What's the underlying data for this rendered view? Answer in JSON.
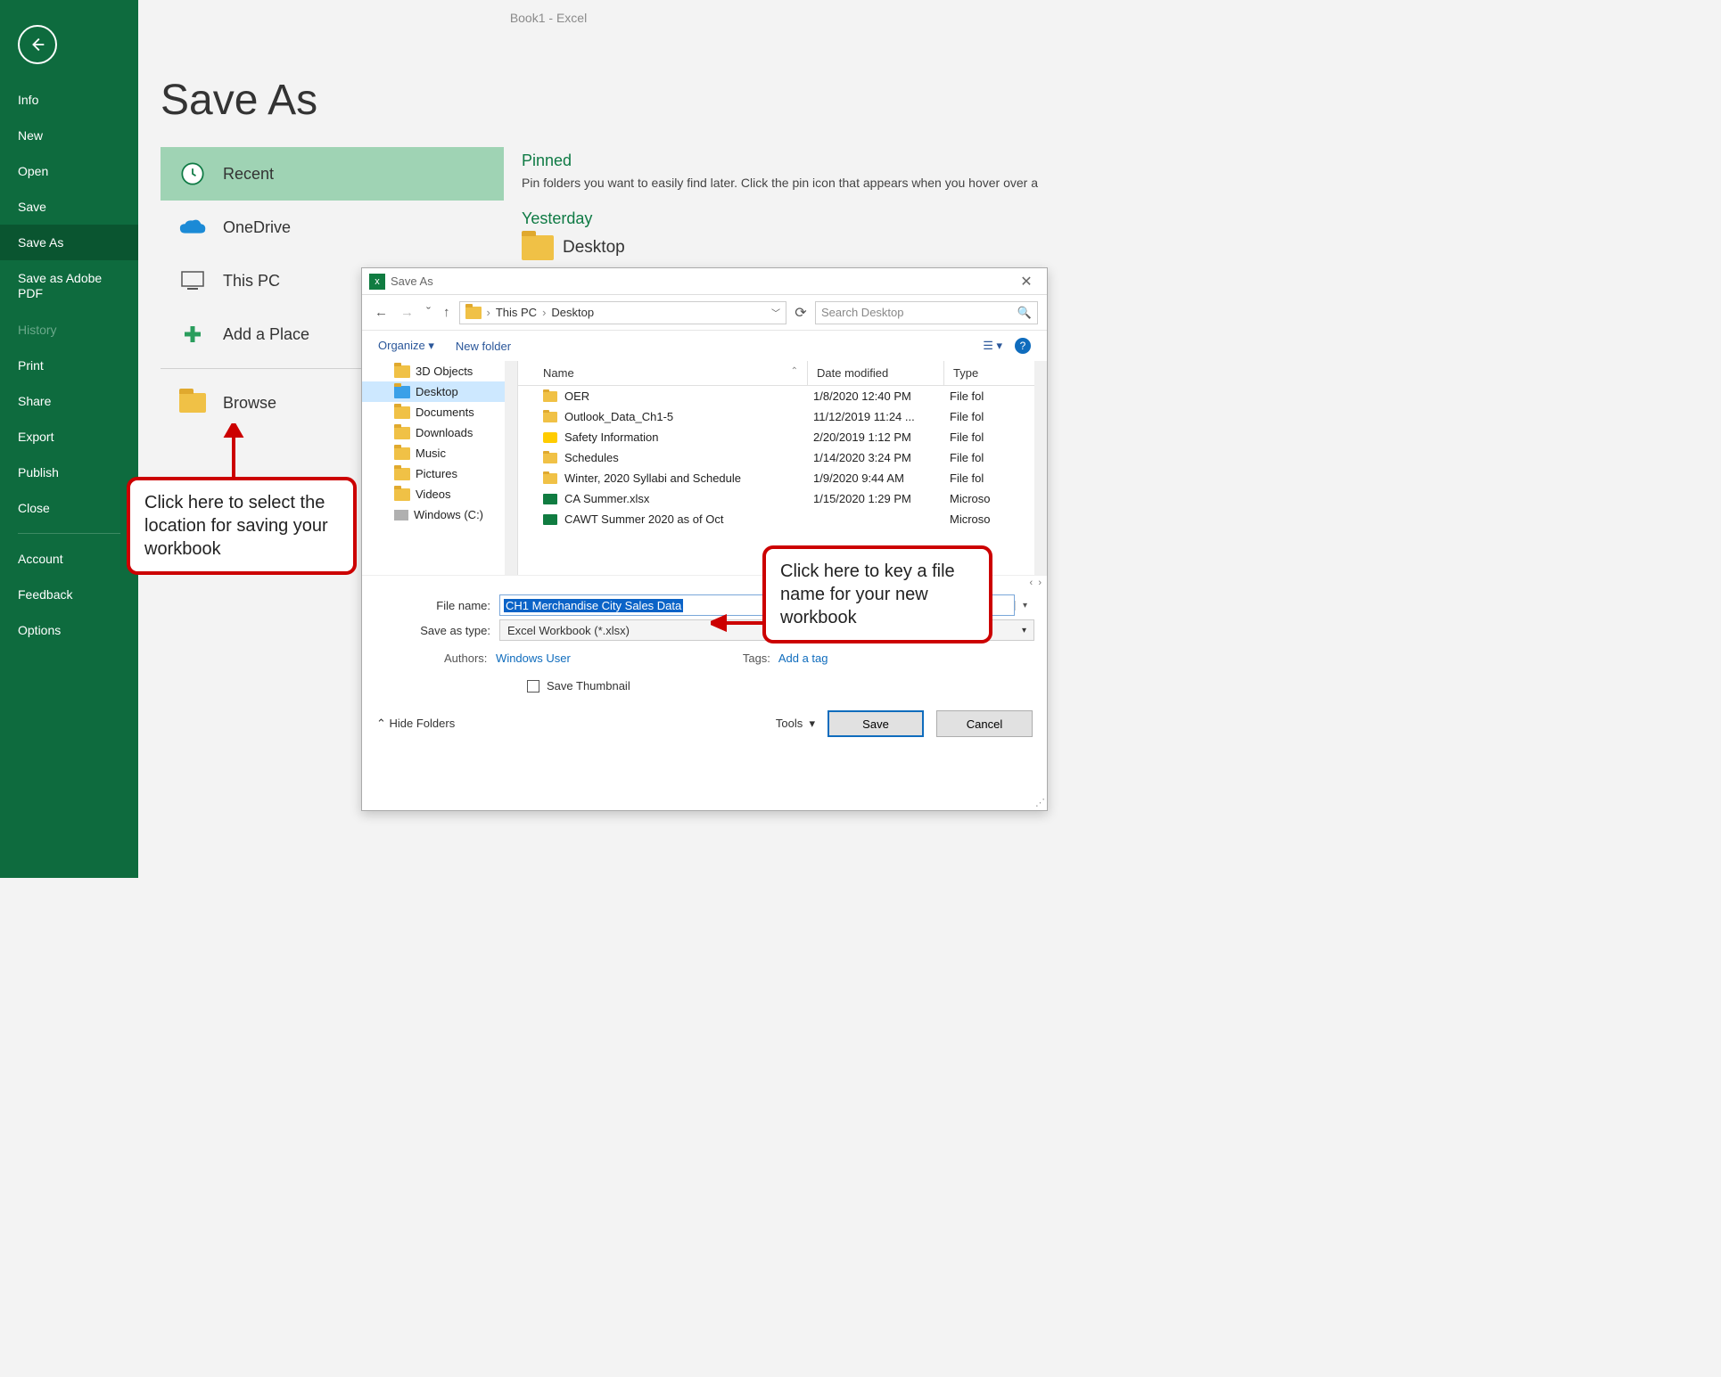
{
  "top_title": "Book1  -  Excel",
  "page_title": "Save As",
  "sidebar": {
    "items": [
      {
        "label": "Info"
      },
      {
        "label": "New"
      },
      {
        "label": "Open"
      },
      {
        "label": "Save"
      },
      {
        "label": "Save As"
      },
      {
        "label": "Save as Adobe PDF"
      },
      {
        "label": "History"
      },
      {
        "label": "Print"
      },
      {
        "label": "Share"
      },
      {
        "label": "Export"
      },
      {
        "label": "Publish"
      },
      {
        "label": "Close"
      }
    ],
    "bottom": [
      "Account",
      "Feedback",
      "Options"
    ]
  },
  "locations": {
    "recent": "Recent",
    "onedrive": "OneDrive",
    "thispc": "This PC",
    "addplace": "Add a Place",
    "browse": "Browse"
  },
  "pinned": {
    "heading": "Pinned",
    "text": "Pin folders you want to easily find later. Click the pin icon that appears when you hover over a",
    "yesterday": "Yesterday",
    "desktop": "Desktop"
  },
  "dialog": {
    "title": "Save As",
    "breadcrumb": {
      "root": "This PC",
      "leaf": "Desktop"
    },
    "search_placeholder": "Search Desktop",
    "toolbar": {
      "organize": "Organize",
      "newfolder": "New folder"
    },
    "tree": [
      "3D Objects",
      "Desktop",
      "Documents",
      "Downloads",
      "Music",
      "Pictures",
      "Videos",
      "Windows (C:)"
    ],
    "headers": {
      "name": "Name",
      "dm": "Date modified",
      "type": "Type"
    },
    "rows": [
      {
        "name": "OER",
        "dm": "1/8/2020 12:40 PM",
        "type": "File fol",
        "icon": "folder"
      },
      {
        "name": "Outlook_Data_Ch1-5",
        "dm": "11/12/2019 11:24 ...",
        "type": "File fol",
        "icon": "folder"
      },
      {
        "name": "Safety Information",
        "dm": "2/20/2019 1:12 PM",
        "type": "File fol",
        "icon": "warn"
      },
      {
        "name": "Schedules",
        "dm": "1/14/2020 3:24 PM",
        "type": "File fol",
        "icon": "folder"
      },
      {
        "name": "Winter, 2020 Syllabi and Schedule",
        "dm": "1/9/2020 9:44 AM",
        "type": "File fol",
        "icon": "folder"
      },
      {
        "name": "CA Summer.xlsx",
        "dm": "1/15/2020 1:29 PM",
        "type": "Microso",
        "icon": "xls"
      },
      {
        "name": "CAWT Summer 2020 as of Oct",
        "dm": "",
        "type": "Microso",
        "icon": "xls"
      }
    ],
    "filename_label": "File name:",
    "filename": "CH1 Merchandise City Sales Data",
    "savetype_label": "Save as type:",
    "savetype": "Excel Workbook (*.xlsx)",
    "authors_label": "Authors:",
    "authors": "Windows User",
    "tags_label": "Tags:",
    "tags": "Add a tag",
    "thumb": "Save Thumbnail",
    "hidefolders": "Hide Folders",
    "tools": "Tools",
    "save": "Save",
    "cancel": "Cancel"
  },
  "callouts": {
    "c1": "Click here to select the location for saving your workbook",
    "c2": "Click here to key a file name for your new workbook"
  }
}
